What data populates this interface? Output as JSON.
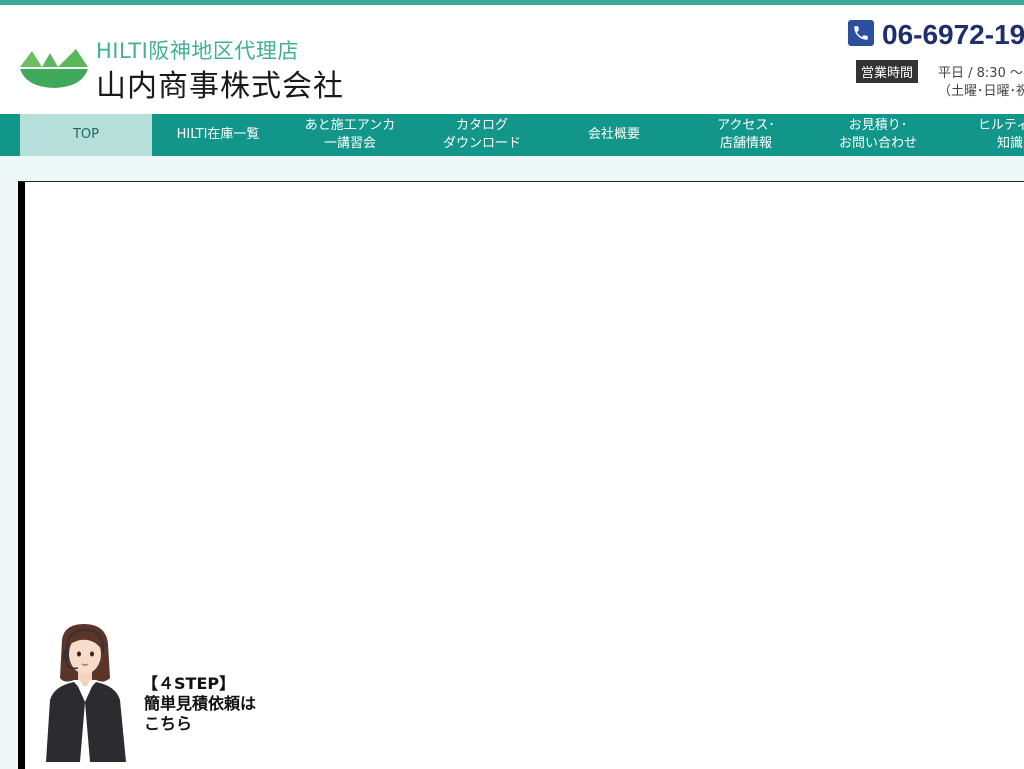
{
  "header": {
    "logo_sub": "HILTI阪神地区代理店",
    "logo_main": "山内商事株式会社",
    "phone": "06-6972-19",
    "hours_badge": "営業時間",
    "hours_text": "平日 / 8:30 〜",
    "hours_closed": "（土曜･日曜･祝"
  },
  "nav": {
    "items": [
      {
        "label": "TOP"
      },
      {
        "label": "HILTI在庫一覧"
      },
      {
        "label": "あと施工アンカ\n一講習会"
      },
      {
        "label": "カタログ\nダウンロード"
      },
      {
        "label": "会社概要"
      },
      {
        "label": "アクセス･\n店舗情報"
      },
      {
        "label": "お見積り･\nお問い合わせ"
      },
      {
        "label": "ヒルティ活\n知識"
      }
    ]
  },
  "cta": {
    "line1": "【４STEP】",
    "line2": "簡単見積依頼は",
    "line3": "こちら"
  },
  "colors": {
    "brand": "#12968a",
    "nav_active": "#b6dfd9",
    "phone_text": "#1f2f6e",
    "logo_green": "#41b08f"
  },
  "icons": {
    "phone": "phone-icon",
    "logo": "mountain-logo-icon",
    "operator": "operator-illustration"
  }
}
